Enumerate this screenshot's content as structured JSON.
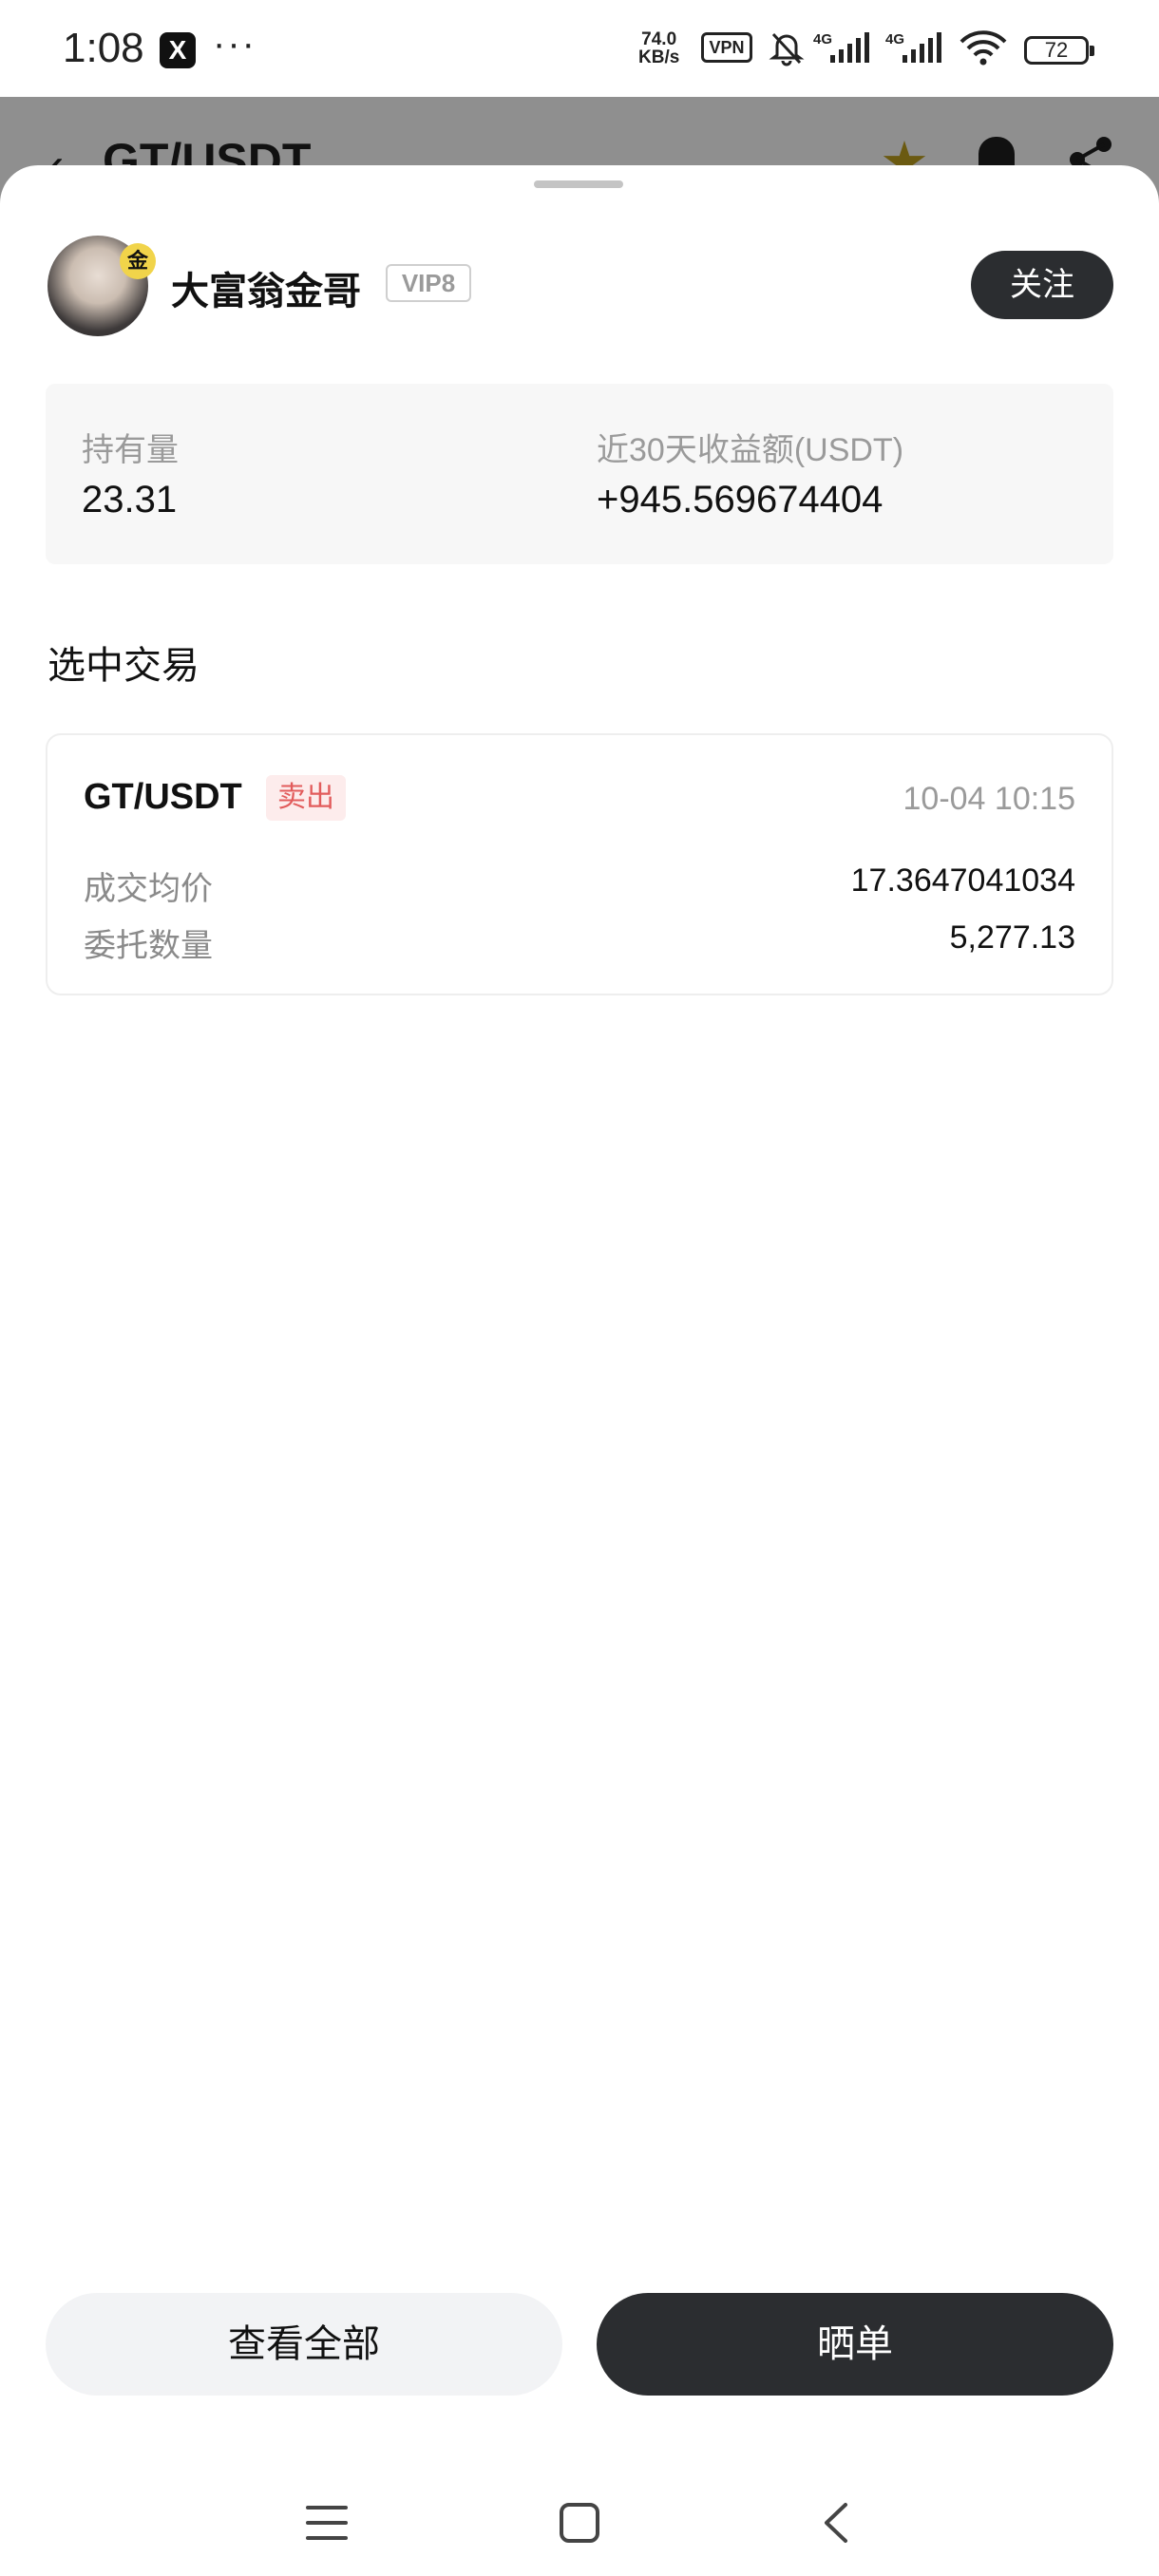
{
  "status_bar": {
    "time": "1:08",
    "app_icon": "x-logo-icon",
    "more": "···",
    "net_speed_value": "74.0",
    "net_speed_unit": "KB/s",
    "vpn": "VPN",
    "battery": "72"
  },
  "background_page": {
    "title": "GT/USDT"
  },
  "sheet": {
    "user": {
      "name": "大富翁金哥",
      "vip": "VIP8",
      "avatar_badge": "金",
      "follow_label": "关注"
    },
    "stats": {
      "holding_label": "持有量",
      "holding_value": "23.31",
      "profit_label": "近30天收益额(USDT)",
      "profit_value": "+945.569674404"
    },
    "section_title": "选中交易",
    "trade": {
      "pair": "GT/USDT",
      "side": "卖出",
      "time": "10-04 10:15",
      "avg_price_label": "成交均价",
      "avg_price_value": "17.3647041034",
      "order_qty_label": "委托数量",
      "order_qty_value": "5,277.13"
    },
    "buttons": {
      "view_all": "查看全部",
      "share": "晒单"
    }
  },
  "colors": {
    "dark_button": "#2b2d30",
    "sell_red": "#e25c5c",
    "muted_text": "#9a9a9a"
  }
}
